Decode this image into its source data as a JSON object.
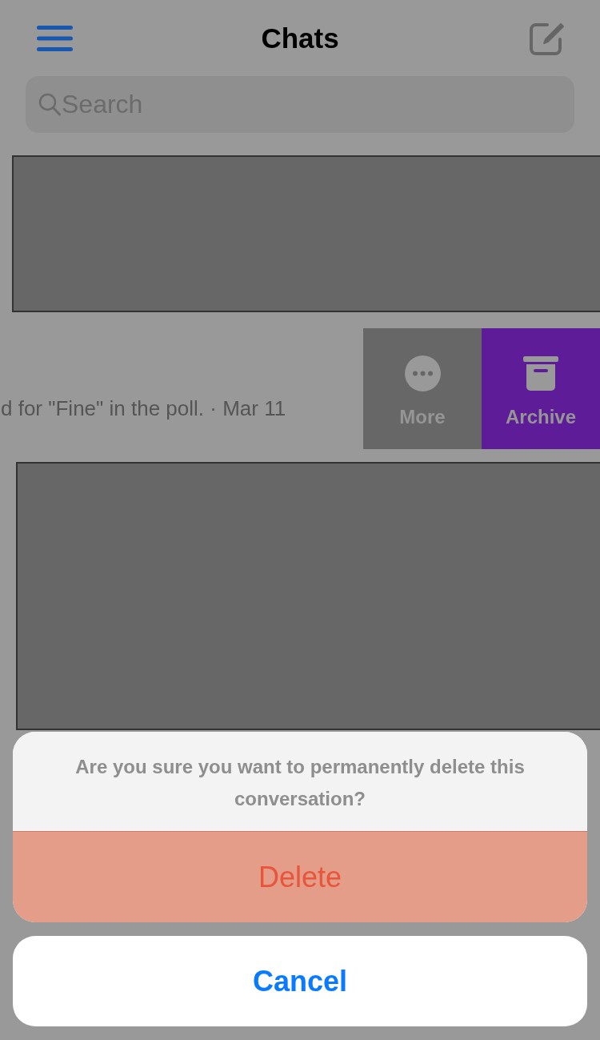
{
  "header": {
    "title": "Chats"
  },
  "search": {
    "placeholder": "Search"
  },
  "chat_rows": [
    {
      "kind": "redacted"
    },
    {
      "kind": "swiped",
      "preview": "d for \"Fine\" in the poll. · Mar 11",
      "actions": [
        {
          "kind": "more",
          "label": "More"
        },
        {
          "kind": "archive",
          "label": "Archive"
        }
      ]
    },
    {
      "kind": "redacted"
    }
  ],
  "action_sheet": {
    "message": "Are you sure you want to permanently delete this conversation?",
    "destructive_button": "Delete",
    "cancel_button": "Cancel"
  }
}
